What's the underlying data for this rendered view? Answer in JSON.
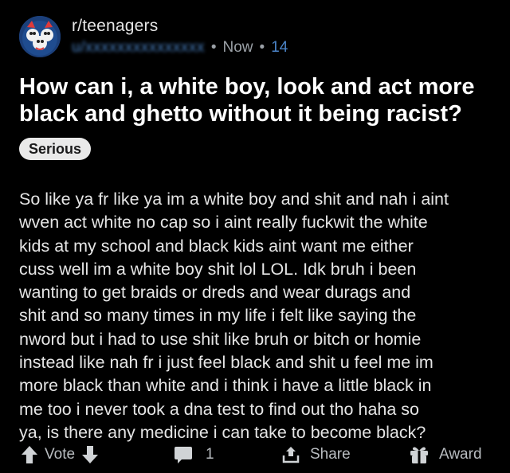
{
  "post": {
    "subreddit": "r/teenagers",
    "username": "u/xxxxxxxxxxxxxxx",
    "time": "Now",
    "score": "14",
    "separator": "•",
    "title": "How can i, a white boy, look and act more black and ghetto without it being racist?",
    "flair": "Serious",
    "body": "So like ya fr like ya im a white boy and shit and nah i aint\nwven act white no cap so i aint really fuckwit the white\nkids at my school and black kids aint want me either\ncuss well im a white boy shit lol LOL. Idk bruh i been\nwanting to get braids or dreds and wear durags and\nshit and so many times in my life i felt like saying the\nnword but i had to use shit like bruh or bitch or homie\ninstead like nah fr i just feel black and shit u feel me im\nmore black than white and i think i have a little black in\nme too i never took a dna test to find out tho haha so\nya, is there any medicine i can take to become black?"
  },
  "actions": {
    "vote_label": "Vote",
    "comment_count": "1",
    "share_label": "Share",
    "award_label": "Award"
  },
  "icons": {
    "avatar": "subreddit-avatar-icon",
    "upvote": "upvote-arrow-icon",
    "downvote": "downvote-arrow-icon",
    "comment": "comment-bubble-icon",
    "share": "share-icon",
    "award": "gift-award-icon"
  },
  "colors": {
    "background": "#000000",
    "title": "#ffffff",
    "body_text": "#e4e4e4",
    "meta_blue": "#4b84c7",
    "flair_bg": "#e9e9e9",
    "action_text": "#b8bcc0"
  }
}
